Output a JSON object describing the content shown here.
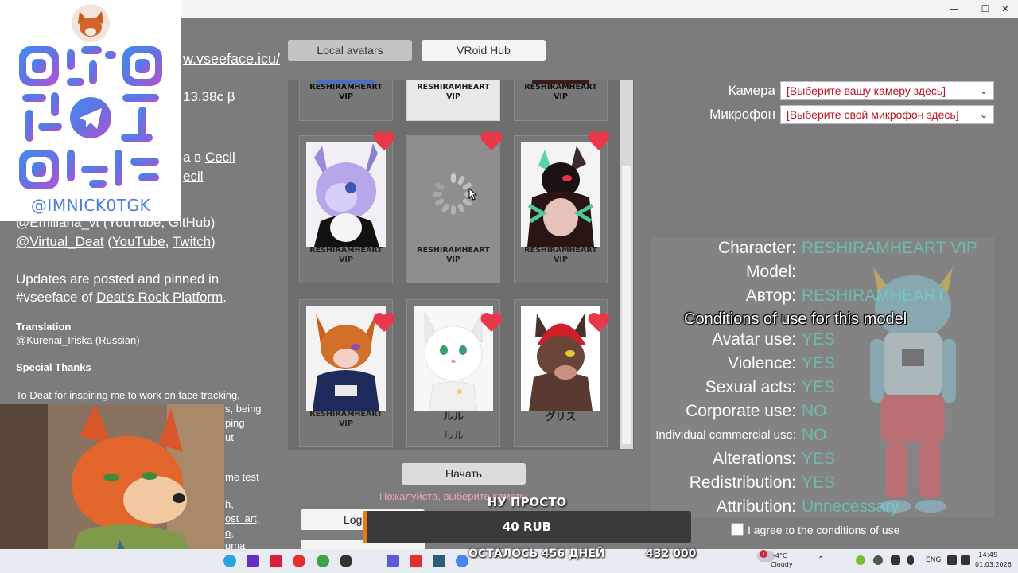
{
  "window": {
    "minimize": "—",
    "maximize": "☐",
    "close": "✕"
  },
  "info": {
    "url_text": "w.vseeface.icu/",
    "version_text": "13.38c β",
    "credit_line1_prefix": "а в ",
    "credit_line1_link": "Cecil",
    "credit_line2_link": "ecil",
    "credit_emiliana": "@Emiliana_vt",
    "emiliana_links": [
      "YouTube",
      "GitHub"
    ],
    "credit_deat": "@Virtual_Deat",
    "deat_links": [
      "YouTube",
      "Twitch"
    ],
    "updates_line1": "Updates are posted and pinned in",
    "updates_line2_prefix": "#vseeface of ",
    "updates_line2_link": "Deat's Rock Platform",
    "updates_line2_suffix": ".",
    "translation_head": "Translation",
    "translator": "@Kurenai_Iriska",
    "translator_lang": " (Russian)",
    "thanks_head": "Special Thanks",
    "thanks_line1": "To Deat for inspiring me to work on face tracking,",
    "thanks_frag1": "s, being",
    "thanks_frag2": "ping",
    "thanks_frag3": "ut",
    "thanks_frag4": "me test",
    "thanks_frag5": "h,",
    "thanks_frag6": "ost_art,",
    "thanks_frag7": "o,",
    "thanks_frag8": "uma"
  },
  "tabs": {
    "local": "Local avatars",
    "vroid": "VRoid Hub"
  },
  "avatars": [
    {
      "name": "RESHIRAMHEART\nVIP"
    },
    {
      "name": "RESHIRAMHEART\nVIP"
    },
    {
      "name": "RESHIRAMHEART\nVIP"
    },
    {
      "name": "RESHIRAMHEART\nVIP"
    },
    {
      "name": "RESHIRAMHEART\nVIP"
    },
    {
      "name": "RESHIRAMHEART\nVIP"
    },
    {
      "name": "RESHIRAMHEART\nVIP"
    },
    {
      "name": "ルル",
      "subtitle": "ルル"
    },
    {
      "name": "グリス"
    }
  ],
  "start_button": "Начать",
  "hint": "Пожалуйста, выберите камеру",
  "log_button": "Log",
  "devices": {
    "camera_label": "Камера",
    "camera_value": "[Выберите вашу камеру здесь]",
    "mic_label": "Микрофон",
    "mic_value": "[Выберите свой микрофон здесь]"
  },
  "character": {
    "character_label": "Character:",
    "character_value": "RESHIRAMHEART VIP",
    "model_label": "Model:",
    "model_value": "",
    "author_label": "Автор:",
    "author_value": "RESHIRAMHEART",
    "conditions_title": "Conditions of use for this model",
    "rows": [
      {
        "label": "Avatar use:",
        "value": "YES"
      },
      {
        "label": "Violence:",
        "value": "YES"
      },
      {
        "label": "Sexual acts:",
        "value": "YES"
      },
      {
        "label": "Corporate use:",
        "value": "NO"
      },
      {
        "label": "Individual commercial use:",
        "value": "NO"
      },
      {
        "label": "Alterations:",
        "value": "YES"
      },
      {
        "label": "Redistribution:",
        "value": "YES"
      },
      {
        "label": "Attribution:",
        "value": "Unnecessary"
      }
    ],
    "agree_label": "I agree to the conditions of use"
  },
  "overlay": {
    "qr_handle": "@IMNICK0TGK",
    "donation_title": "НУ ПРОСТО",
    "donation_amount": "40 RUB",
    "donation_progress": 0.012,
    "days_left": "ОСТАЛОСЬ 456 ДНЕЙ",
    "goal_total": "432 000"
  },
  "taskbar": {
    "weather_temp": "-4°C",
    "weather_desc": "Cloudy",
    "weather_badge": "1",
    "lang": "ENG",
    "time": "14:49",
    "date": "01.03.2026"
  },
  "colors": {
    "accent_red": "#c0141e",
    "value_cyan": "#5de8d0",
    "heart": "#e8394a",
    "qr_blue": "#4b7fe0"
  }
}
